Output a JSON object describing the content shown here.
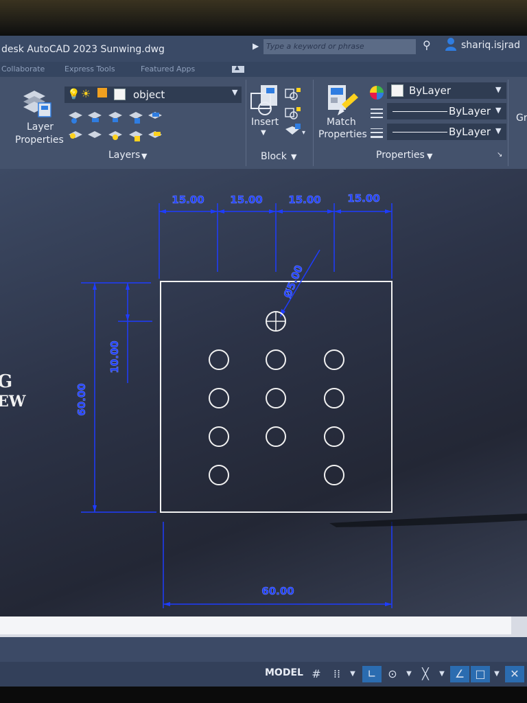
{
  "window": {
    "title": "desk AutoCAD 2023   Sunwing.dwg",
    "search_placeholder": "Type a keyword or phrase",
    "username": "shariq.isjrad"
  },
  "tabs": [
    "Collaborate",
    "Express Tools",
    "Featured Apps"
  ],
  "ribbon": {
    "layer_properties_label": "Layer\nProperties",
    "layer_properties_line1": "Layer",
    "layer_properties_line2": "Properties",
    "current_layer": "object",
    "layers_panel": "Layers",
    "insert_label": "Insert",
    "block_panel": "Block",
    "match_line1": "Match",
    "match_line2": "Properties",
    "color_value": "ByLayer",
    "linetype_value": "ByLayer",
    "lineweight_value": "ByLayer",
    "properties_panel": "Properties",
    "groups_partial": "Gr"
  },
  "drawing": {
    "dims": {
      "top_spacing": [
        "15.00",
        "15.00",
        "15.00",
        "15.00"
      ],
      "hole_diameter": "Ø5.00",
      "vertical_offset": "10.00",
      "overall_height": "60.00",
      "overall_width": "60.00"
    },
    "left_edge_text": [
      "G",
      "EW"
    ],
    "hole_rows": [
      [
        false,
        true,
        false
      ],
      [
        true,
        true,
        true
      ],
      [
        true,
        true,
        true
      ],
      [
        true,
        true,
        true
      ],
      [
        true,
        false,
        true
      ]
    ]
  },
  "status": {
    "model_label": "MODEL"
  },
  "colors": {
    "ribbon": "#44526c",
    "titlebar": "#3a4a66",
    "dimension": "#1e3cff",
    "geometry": "#f2f2f2",
    "accent": "#2b6cb0"
  }
}
